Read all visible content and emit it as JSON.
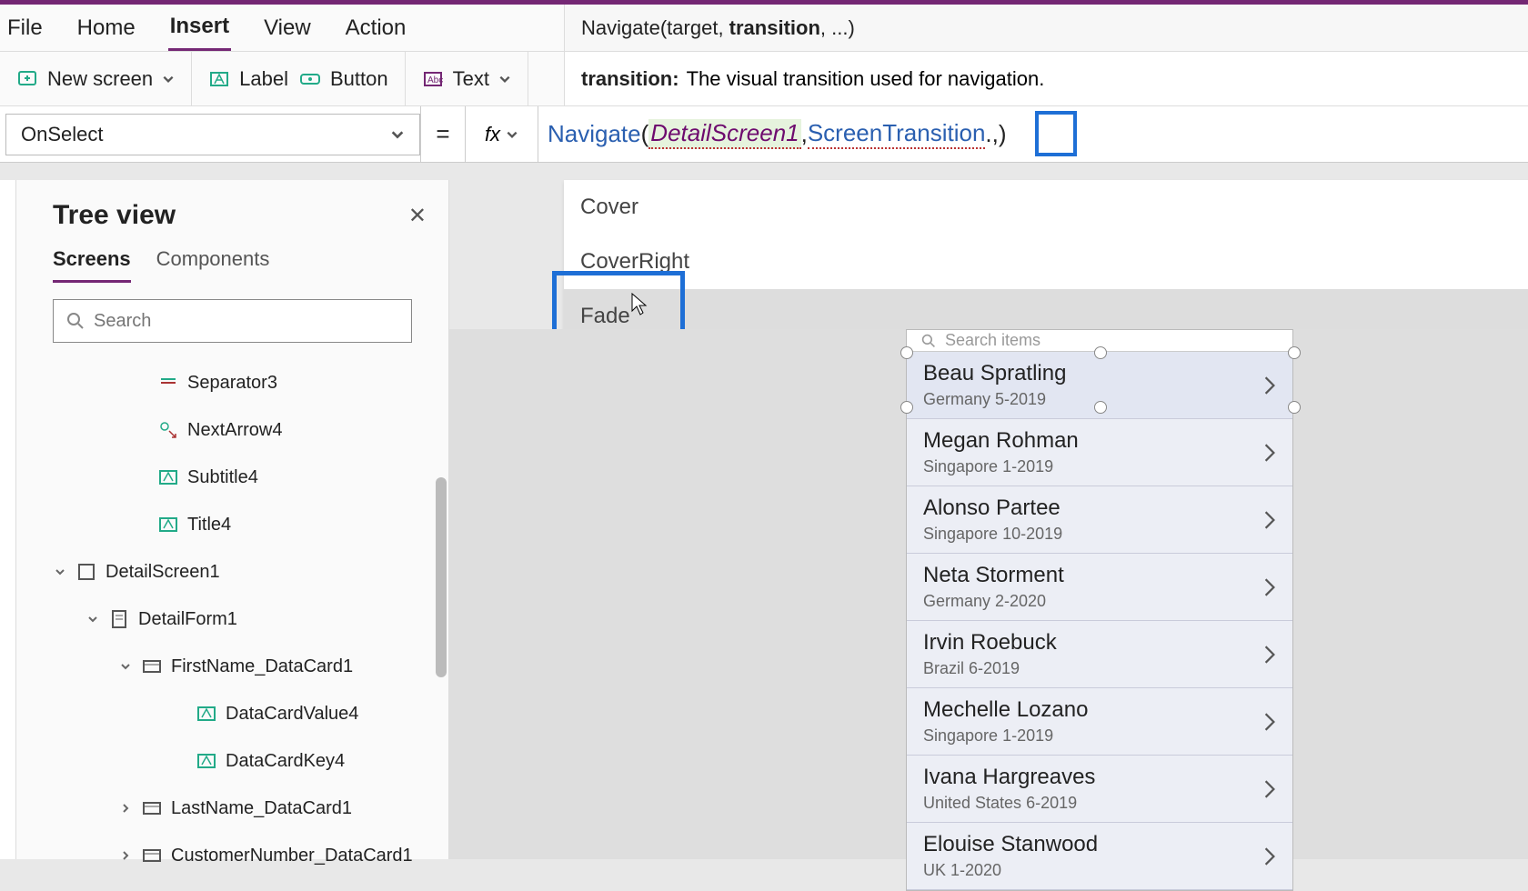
{
  "menu": {
    "file": "File",
    "home": "Home",
    "insert": "Insert",
    "view": "View",
    "action": "Action"
  },
  "signature": {
    "fn": "Navigate",
    "arg1": "target",
    "arg2": "transition",
    "rest": "..."
  },
  "ribbon": {
    "new_screen": "New screen",
    "label": "Label",
    "button": "Button",
    "text": "Text"
  },
  "param_help": {
    "name": "transition:",
    "desc": "The visual transition used for navigation."
  },
  "property_dropdown": "OnSelect",
  "equals": "=",
  "fx": "fx",
  "formula": {
    "fn": "Navigate",
    "open": "(",
    "arg1": "DetailScreen1",
    "comma1": ", ",
    "arg2": "ScreenTransition",
    "tail": ".,)"
  },
  "autocomplete": [
    "Cover",
    "CoverRight",
    "Fade"
  ],
  "tree": {
    "title": "Tree view",
    "tabs": {
      "screens": "Screens",
      "components": "Components"
    },
    "search_placeholder": "Search",
    "nodes": [
      {
        "label": "Separator3",
        "indent": 130,
        "icon": "sep"
      },
      {
        "label": "NextArrow4",
        "indent": 130,
        "icon": "arrow"
      },
      {
        "label": "Subtitle4",
        "indent": 130,
        "icon": "label"
      },
      {
        "label": "Title4",
        "indent": 130,
        "icon": "label"
      },
      {
        "label": "DetailScreen1",
        "indent": 40,
        "icon": "screen",
        "exp": "down"
      },
      {
        "label": "DetailForm1",
        "indent": 76,
        "icon": "form",
        "exp": "down"
      },
      {
        "label": "FirstName_DataCard1",
        "indent": 112,
        "icon": "card",
        "exp": "down"
      },
      {
        "label": "DataCardValue4",
        "indent": 172,
        "icon": "label"
      },
      {
        "label": "DataCardKey4",
        "indent": 172,
        "icon": "label"
      },
      {
        "label": "LastName_DataCard1",
        "indent": 112,
        "icon": "card",
        "exp": "right"
      },
      {
        "label": "CustomerNumber_DataCard1",
        "indent": 112,
        "icon": "card",
        "exp": "right"
      }
    ]
  },
  "preview": {
    "search_label": "Search items",
    "items": [
      {
        "title": "Beau Spratling",
        "sub": "Germany 5-2019"
      },
      {
        "title": "Megan Rohman",
        "sub": "Singapore 1-2019"
      },
      {
        "title": "Alonso Partee",
        "sub": "Singapore 10-2019"
      },
      {
        "title": "Neta Storment",
        "sub": "Germany 2-2020"
      },
      {
        "title": "Irvin Roebuck",
        "sub": "Brazil 6-2019"
      },
      {
        "title": "Mechelle Lozano",
        "sub": "Singapore 1-2019"
      },
      {
        "title": "Ivana Hargreaves",
        "sub": "United States 6-2019"
      },
      {
        "title": "Elouise Stanwood",
        "sub": "UK 1-2020"
      }
    ]
  }
}
